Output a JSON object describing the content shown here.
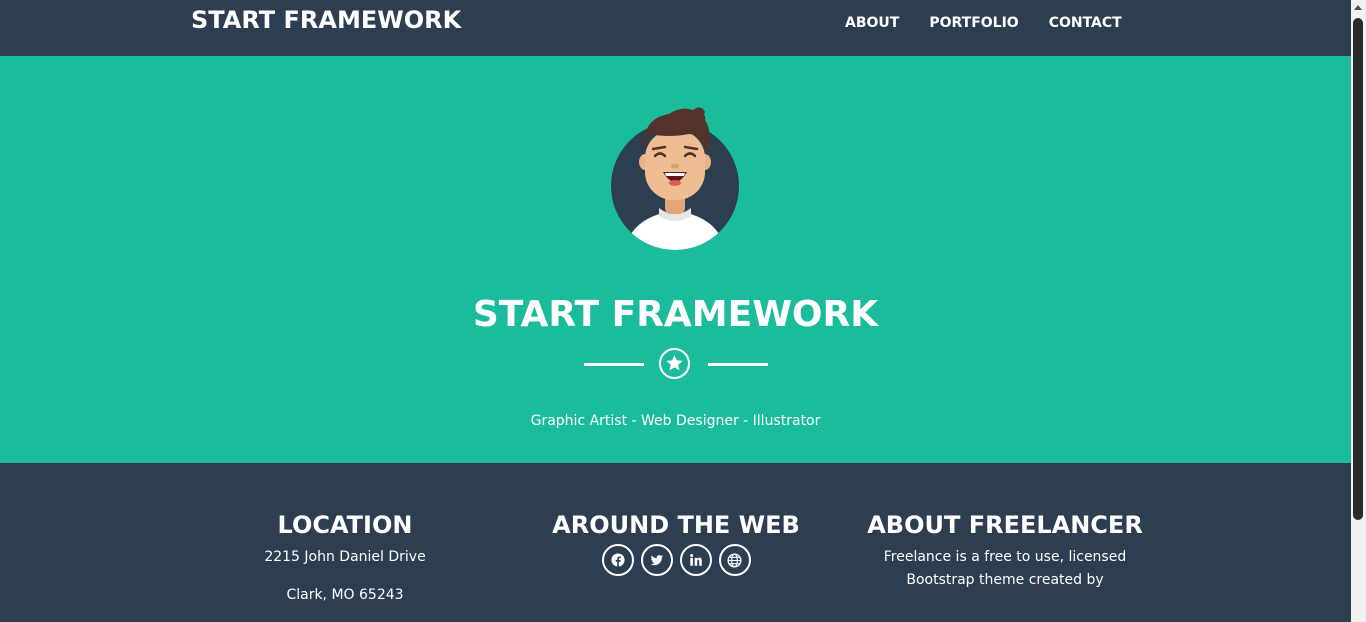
{
  "navbar": {
    "brand": "START FRAMEWORK",
    "links": [
      "ABOUT",
      "PORTFOLIO",
      "CONTACT"
    ]
  },
  "masthead": {
    "title": "START FRAMEWORK",
    "divider_icon": "star-icon",
    "subtitle": "Graphic Artist - Web Designer - Illustrator"
  },
  "footer": {
    "location": {
      "heading": "LOCATION",
      "line1": "2215 John Daniel Drive",
      "line2": "Clark, MO 65243"
    },
    "web": {
      "heading": "AROUND THE WEB",
      "icons": [
        "facebook-icon",
        "twitter-icon",
        "linkedin-icon",
        "globe-icon"
      ]
    },
    "about": {
      "heading": "ABOUT FREELANCER",
      "text": "Freelance is a free to use, licensed Bootstrap theme created by"
    }
  },
  "colors": {
    "primary": "#2c3e50",
    "accent": "#1abc9c",
    "text": "#ffffff"
  }
}
